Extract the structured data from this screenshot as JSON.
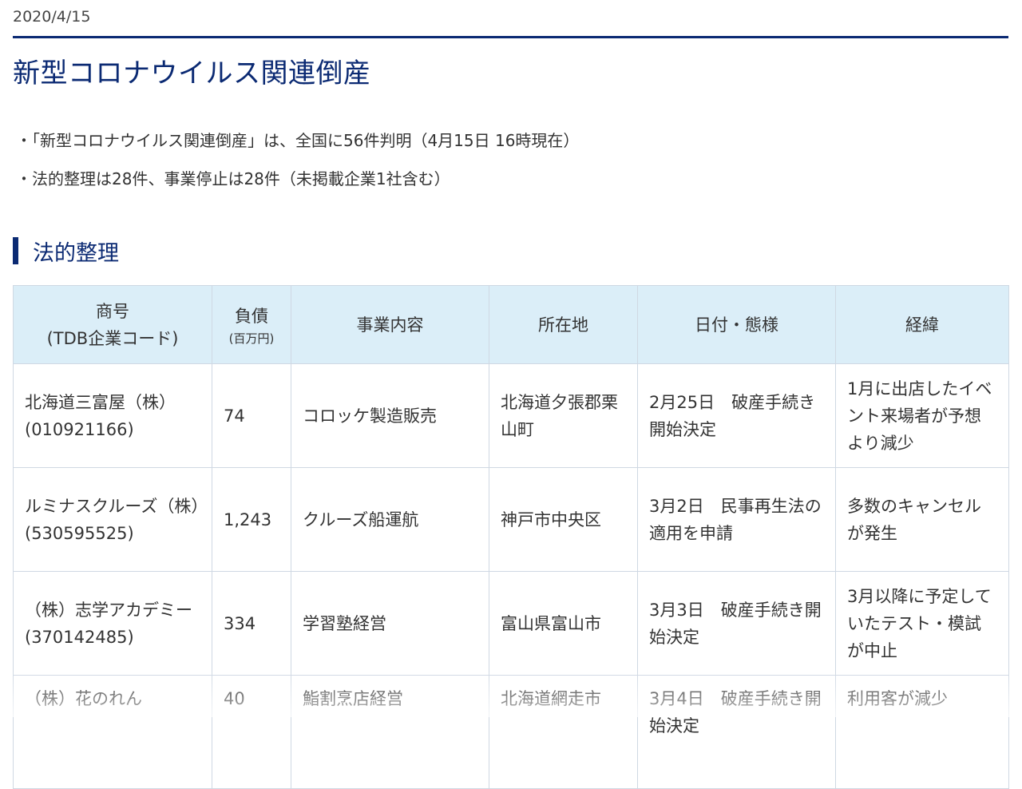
{
  "date": "2020/4/15",
  "title": "新型コロナウイルス関連倒産",
  "bullets": [
    "・「新型コロナウイルス関連倒産」は、全国に56件判明（4月15日 16時現在）",
    "・法的整理は28件、事業停止は28件（未掲載企業1社含む）"
  ],
  "section_title": "法的整理",
  "table": {
    "headers": {
      "company": "商号",
      "company_sub": "(TDB企業コード)",
      "debt": "負債",
      "debt_sub": "(百万円)",
      "business": "事業内容",
      "location": "所在地",
      "date_status": "日付・態様",
      "reason": "経緯"
    },
    "rows": [
      {
        "name": "北海道三富屋（株）",
        "code": "(010921166)",
        "debt": "74",
        "business": "コロッケ製造販売",
        "location": "北海道夕張郡栗山町",
        "date_status": "2月25日　破産手続き開始決定",
        "reason": "1月に出店したイベント来場者が予想より減少"
      },
      {
        "name": "ルミナスクルーズ（株）",
        "code": "(530595525)",
        "debt": "1,243",
        "business": "クルーズ船運航",
        "location": "神戸市中央区",
        "date_status": "3月2日　民事再生法の適用を申請",
        "reason": "多数のキャンセルが発生"
      },
      {
        "name": "（株）志学アカデミー",
        "code": "(370142485)",
        "debt": "334",
        "business": "学習塾経営",
        "location": "富山県富山市",
        "date_status": "3月3日　破産手続き開始決定",
        "reason": "3月以降に予定していたテスト・模試が中止"
      },
      {
        "name": "（株）花のれん",
        "code": "",
        "debt": "40",
        "business": "鮨割烹店経営",
        "location": "北海道網走市",
        "date_status": "3月4日　破産手続き開始決定",
        "reason": "利用客が減少"
      }
    ]
  }
}
